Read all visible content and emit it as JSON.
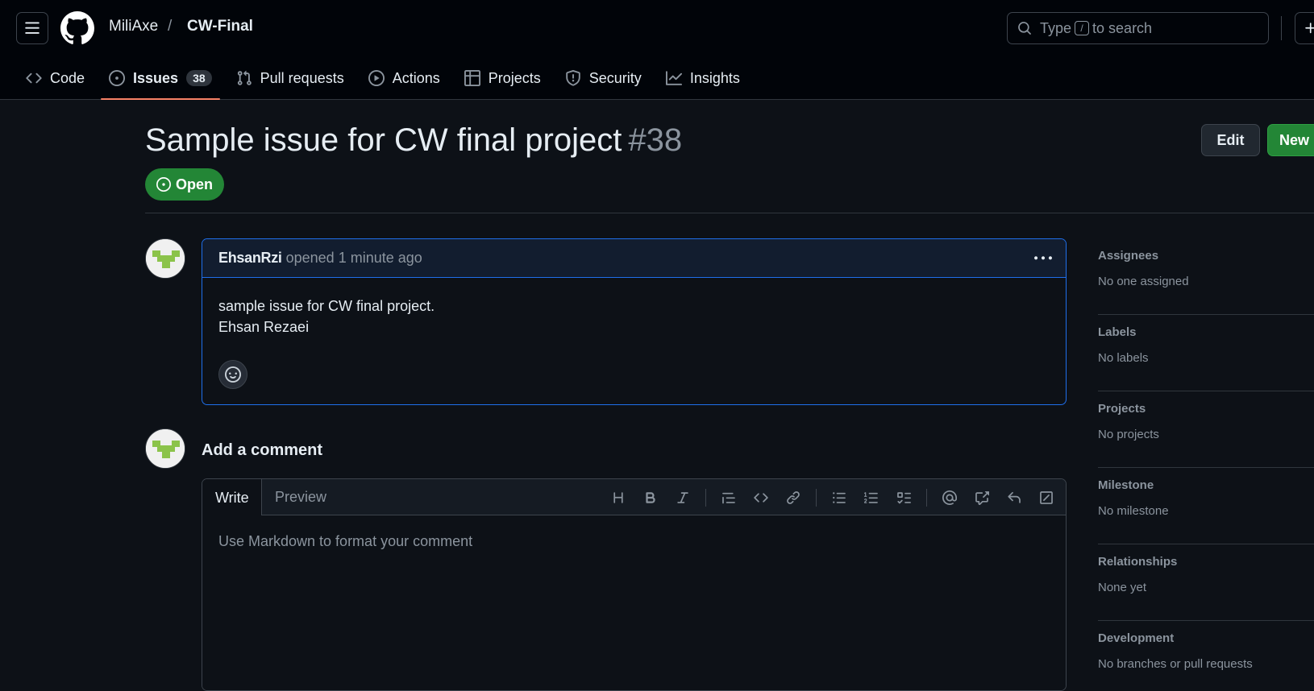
{
  "header": {
    "owner": "MiliAxe",
    "separator": "/",
    "repo": "CW-Final",
    "search": {
      "prefix": "Type",
      "key": "/",
      "suffix": "to search"
    }
  },
  "tabs": [
    {
      "label": "Code",
      "icon": "code-icon"
    },
    {
      "label": "Issues",
      "icon": "issue-opened-icon",
      "count": "38",
      "active": true
    },
    {
      "label": "Pull requests",
      "icon": "git-pull-request-icon"
    },
    {
      "label": "Actions",
      "icon": "play-icon"
    },
    {
      "label": "Projects",
      "icon": "table-icon"
    },
    {
      "label": "Security",
      "icon": "shield-icon"
    },
    {
      "label": "Insights",
      "icon": "graph-icon"
    }
  ],
  "issue": {
    "title": "Sample issue for CW final project",
    "number": "#38",
    "state": "Open",
    "edit_label": "Edit",
    "new_label": "New issue"
  },
  "comment": {
    "author": "EhsanRzi",
    "meta": "opened 1 minute ago",
    "body_line1": "sample issue for CW final project.",
    "body_line2": "Ehsan Rezaei"
  },
  "add_comment": {
    "heading": "Add a comment",
    "write_tab": "Write",
    "preview_tab": "Preview",
    "placeholder": "Use Markdown to format your comment",
    "toolbar": [
      "heading",
      "bold",
      "italic",
      "quote",
      "code",
      "link",
      "unordered-list",
      "ordered-list",
      "task-list",
      "mention",
      "reference",
      "undo",
      "slash-commands"
    ]
  },
  "sidebar": [
    {
      "title": "Assignees",
      "value": "No one assigned"
    },
    {
      "title": "Labels",
      "value": "No labels"
    },
    {
      "title": "Projects",
      "value": "No projects"
    },
    {
      "title": "Milestone",
      "value": "No milestone"
    },
    {
      "title": "Relationships",
      "value": "None yet"
    },
    {
      "title": "Development",
      "value": "No branches or pull requests"
    }
  ],
  "colors": {
    "background": "#0d1117",
    "header_bg": "#010409",
    "open_green": "#238636",
    "active_tab_underline": "#f78166",
    "comment_border": "#1f6feb"
  }
}
